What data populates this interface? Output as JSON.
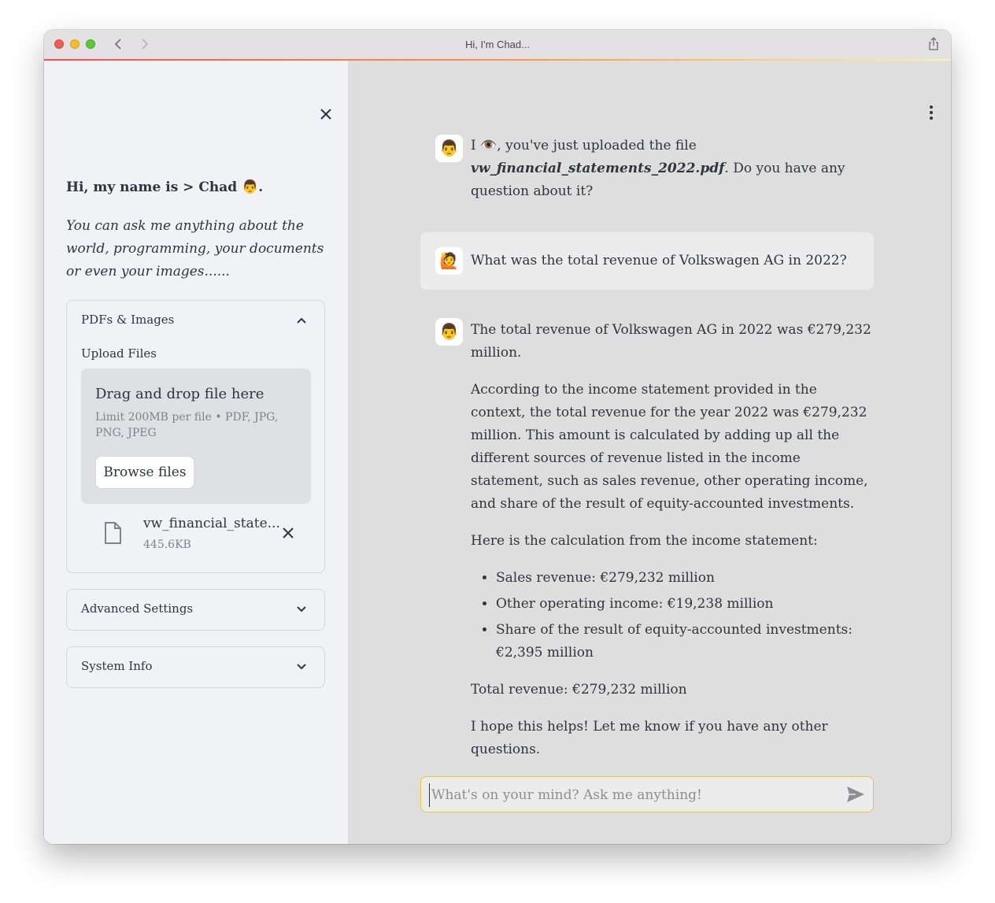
{
  "window": {
    "title": "Hi, I'm Chad..."
  },
  "sidebar": {
    "greeting": "Hi, my name is > Chad 👨.",
    "intro": "You can ask me anything about the world, programming, your documents or even your images......",
    "pdfs_expander": {
      "title": "PDFs & Images",
      "upload_label": "Upload Files",
      "dropzone_title": "Drag and drop file here",
      "dropzone_subtitle": "Limit 200MB per file • PDF, JPG, PNG, JPEG",
      "browse_label": "Browse files",
      "file_name": "vw_financial_state...",
      "file_size": "445.6KB"
    },
    "advanced_expander": {
      "title": "Advanced Settings"
    },
    "system_expander": {
      "title": "System Info"
    }
  },
  "chat": {
    "assistant_avatar": "👨",
    "user_avatar": "🙋",
    "message1": {
      "prefix": "I 👁️, you've just uploaded the file ",
      "file": "vw_financial_statements_2022.pdf",
      "suffix": ". Do you have any question about it?"
    },
    "user_message": "What was the total revenue of Volkswagen AG in 2022?",
    "answer": {
      "p1": "The total revenue of Volkswagen AG in 2022 was €279,232 million.",
      "p2": "According to the income statement provided in the context, the total revenue for the year 2022 was €279,232 million. This amount is calculated by adding up all the different sources of revenue listed in the income statement, such as sales revenue, other operating income, and share of the result of equity-accounted investments.",
      "p3": "Here is the calculation from the income statement:",
      "bullets": [
        "Sales revenue: €279,232 million",
        "Other operating income: €19,238 million",
        "Share of the result of equity-accounted investments: €2,395 million"
      ],
      "p4": "Total revenue: €279,232 million",
      "p5": "I hope this helps! Let me know if you have any other questions."
    },
    "input_placeholder": "What's on your mind? Ask me anything!"
  },
  "colors": {
    "accent_gradient_start": "#ff4b4b",
    "accent_gradient_end": "#fff3a0",
    "input_border": "#f4c542"
  }
}
